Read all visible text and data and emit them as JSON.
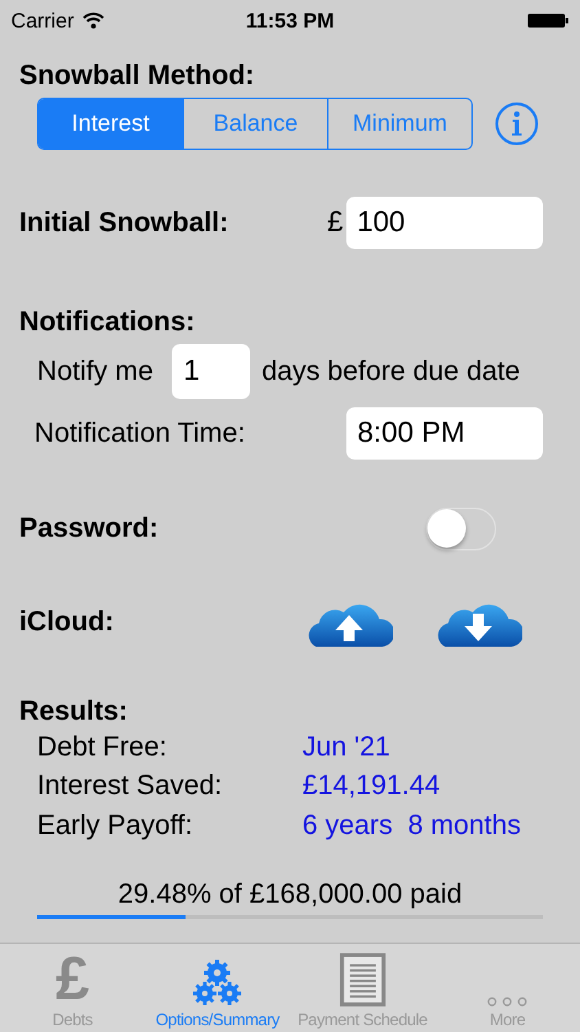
{
  "status_bar": {
    "carrier": "Carrier",
    "time": "11:53 PM"
  },
  "snowball_method": {
    "label": "Snowball Method:",
    "segments": [
      {
        "label": "Interest",
        "selected": true
      },
      {
        "label": "Balance",
        "selected": false
      },
      {
        "label": "Minimum",
        "selected": false
      }
    ]
  },
  "initial_snowball": {
    "label": "Initial Snowball:",
    "currency": "£",
    "value": "100"
  },
  "notifications": {
    "label": "Notifications:",
    "notify_prefix": "Notify me",
    "days": "1",
    "notify_suffix": "days before due date",
    "time_label": "Notification Time:",
    "time": "8:00 PM"
  },
  "password": {
    "label": "Password:",
    "on": false
  },
  "icloud": {
    "label": "iCloud:"
  },
  "results": {
    "label": "Results:",
    "rows": [
      {
        "label": "Debt Free:",
        "value": "Jun '21"
      },
      {
        "label": "Interest Saved:",
        "value": "£14,191.44"
      },
      {
        "label": "Early Payoff:",
        "value": "6 years  8 months"
      }
    ]
  },
  "progress": {
    "text": "29.48% of £168,000.00 paid",
    "level": 0.2948
  },
  "tab_bar": [
    {
      "kind": "pound",
      "glyph": "£",
      "label": "Debts",
      "selected": false
    },
    {
      "kind": "gears",
      "label": "Options/Summary",
      "selected": true
    },
    {
      "kind": "document",
      "label": "Payment Schedule",
      "selected": false
    },
    {
      "kind": "more",
      "label": "More",
      "selected": false
    }
  ]
}
